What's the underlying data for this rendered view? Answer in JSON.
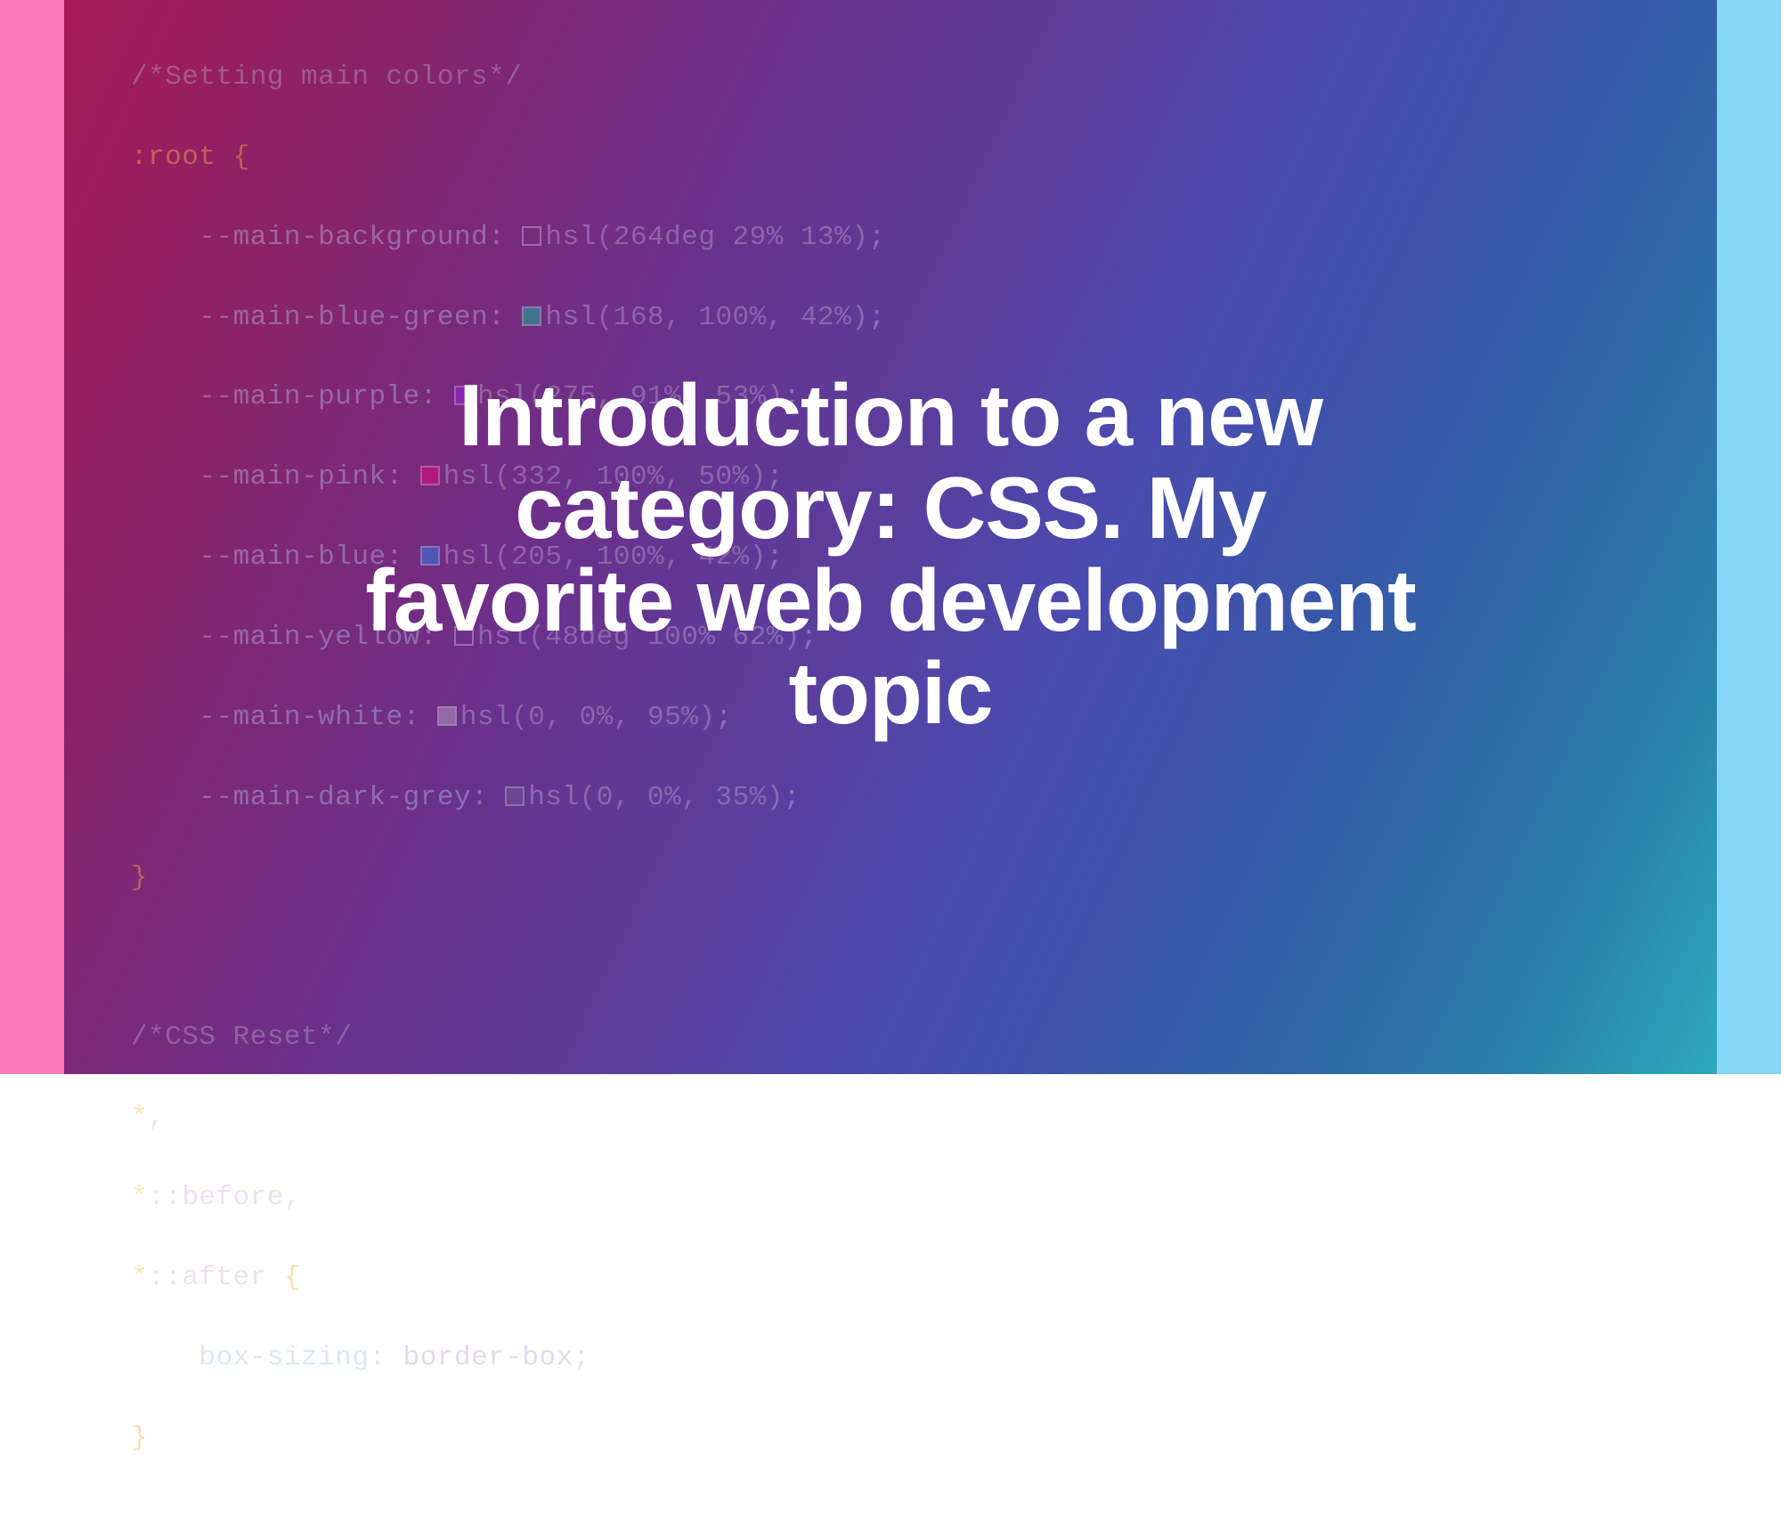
{
  "hero": {
    "title": "Introduction to a new category: CSS. My favorite web development topic"
  },
  "code": {
    "comment1": "/*Setting main colors*/",
    "root_selector": ":root",
    "open_brace": "{",
    "close_brace": "}",
    "vars": {
      "bg_prop": "--main-background",
      "bg_func": "hsl",
      "bg_args": "(264deg 29% 13%)",
      "bluegreen_prop": "--main-blue-green",
      "bluegreen_func": "hsl",
      "bluegreen_args": "(168, 100%, 42%)",
      "purple_prop": "--main-purple",
      "purple_func": "hsl",
      "purple_args": "(275, 91%, 53%)",
      "pink_prop": "--main-pink",
      "pink_func": "hsl",
      "pink_args": "(332, 100%, 50%)",
      "blue_prop": "--main-blue",
      "blue_func": "hsl",
      "blue_args": "(205, 100%, 42%)",
      "yellow_prop": "--main-yellow",
      "yellow_func": "hsl",
      "yellow_args": "(48deg 100% 62%)",
      "white_prop": "--main-white",
      "white_func": "hsl",
      "white_args": "(0, 0%, 95%)",
      "grey_prop": "--main-dark-grey",
      "grey_func": "hsl",
      "grey_args": "(0, 0%, 35%)"
    },
    "comment2": "/*CSS Reset*/",
    "reset": {
      "star": "*",
      "comma": ",",
      "star_before": "*::before",
      "star_after": "*::after",
      "prop": "box-sizing",
      "val": "border-box"
    },
    "colon": ":",
    "semi": ";"
  }
}
